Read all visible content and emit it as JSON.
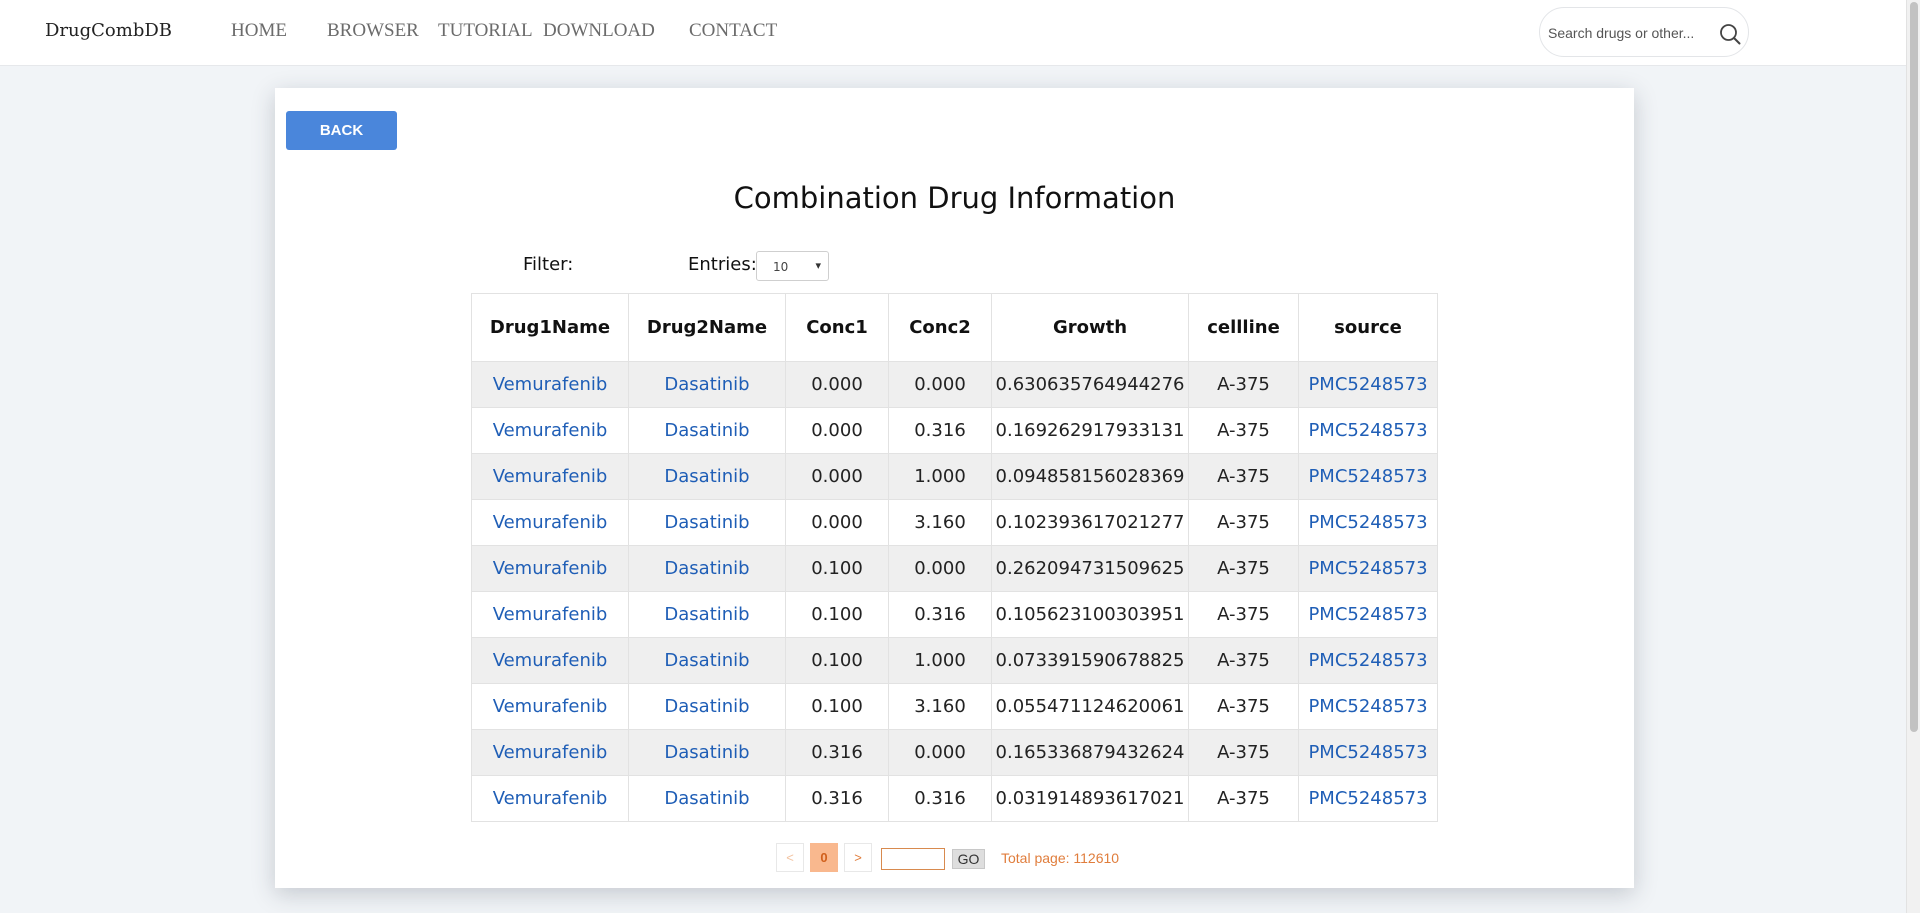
{
  "nav": {
    "brand": "DrugCombDB",
    "links": [
      {
        "label": "HOME"
      },
      {
        "label": "BROWSER"
      },
      {
        "label": "TUTORIAL"
      },
      {
        "label": "DOWNLOAD"
      },
      {
        "label": "CONTACT"
      }
    ],
    "search_placeholder": "Search drugs or other...",
    "search_icon": "magnifier"
  },
  "card": {
    "back_label": "BACK",
    "title": "Combination Drug Information",
    "filter_label": "Filter:",
    "entries_label": "Entries:",
    "entries_value": "10"
  },
  "table": {
    "columns": [
      "Drug1Name",
      "Drug2Name",
      "Conc1",
      "Conc2",
      "Growth",
      "cellline",
      "source"
    ],
    "rows": [
      {
        "drug1": "Vemurafenib",
        "drug2": "Dasatinib",
        "conc1": "0.000",
        "conc2": "0.000",
        "growth": "0.630635764944276",
        "cellline": "A-375",
        "source": "PMC5248573"
      },
      {
        "drug1": "Vemurafenib",
        "drug2": "Dasatinib",
        "conc1": "0.000",
        "conc2": "0.316",
        "growth": "0.169262917933131",
        "cellline": "A-375",
        "source": "PMC5248573"
      },
      {
        "drug1": "Vemurafenib",
        "drug2": "Dasatinib",
        "conc1": "0.000",
        "conc2": "1.000",
        "growth": "0.094858156028369",
        "cellline": "A-375",
        "source": "PMC5248573"
      },
      {
        "drug1": "Vemurafenib",
        "drug2": "Dasatinib",
        "conc1": "0.000",
        "conc2": "3.160",
        "growth": "0.102393617021277",
        "cellline": "A-375",
        "source": "PMC5248573"
      },
      {
        "drug1": "Vemurafenib",
        "drug2": "Dasatinib",
        "conc1": "0.100",
        "conc2": "0.000",
        "growth": "0.262094731509625",
        "cellline": "A-375",
        "source": "PMC5248573"
      },
      {
        "drug1": "Vemurafenib",
        "drug2": "Dasatinib",
        "conc1": "0.100",
        "conc2": "0.316",
        "growth": "0.105623100303951",
        "cellline": "A-375",
        "source": "PMC5248573"
      },
      {
        "drug1": "Vemurafenib",
        "drug2": "Dasatinib",
        "conc1": "0.100",
        "conc2": "1.000",
        "growth": "0.073391590678825",
        "cellline": "A-375",
        "source": "PMC5248573"
      },
      {
        "drug1": "Vemurafenib",
        "drug2": "Dasatinib",
        "conc1": "0.100",
        "conc2": "3.160",
        "growth": "0.055471124620061",
        "cellline": "A-375",
        "source": "PMC5248573"
      },
      {
        "drug1": "Vemurafenib",
        "drug2": "Dasatinib",
        "conc1": "0.316",
        "conc2": "0.000",
        "growth": "0.165336879432624",
        "cellline": "A-375",
        "source": "PMC5248573"
      },
      {
        "drug1": "Vemurafenib",
        "drug2": "Dasatinib",
        "conc1": "0.316",
        "conc2": "0.316",
        "growth": "0.031914893617021",
        "cellline": "A-375",
        "source": "PMC5248573"
      }
    ]
  },
  "pagination": {
    "prev_label": "<",
    "current_page": "0",
    "next_label": ">",
    "goto_value": "",
    "go_label": "GO",
    "total_text": "Total page: 112610"
  },
  "colors": {
    "accent": "#4a86db",
    "link": "#1f5eb6",
    "pager": "#e07d3c"
  }
}
